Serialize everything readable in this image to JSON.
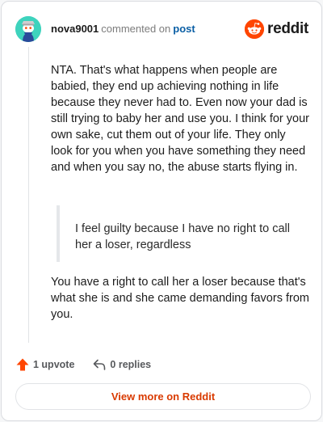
{
  "comment": {
    "username": "nova9001",
    "action_text": "commented on",
    "post_link": "post",
    "brand": "reddit",
    "paragraphs": [
      "NTA. That's what happens when people are babied, they end up achieving nothing in life because they never had to. Even now your dad is still trying to baby her and use you. I think for your own sake, cut them out of your life. They only look for you when you have something they need and when you say no, the abuse starts flying in.",
      "You have a right to call her a loser because that's what she is and she came demanding favors from you."
    ],
    "quote": "I feel guilty because I have no right to call her a loser, regardless"
  },
  "footer": {
    "upvotes": "1 upvote",
    "replies": "0 replies",
    "view_more": "View more on Reddit"
  },
  "colors": {
    "avatar_bg": "#3ed3bd",
    "brand_orange": "#ff4500",
    "link_blue": "#0b5fa5",
    "view_more_text": "#d93a00"
  },
  "icons": {
    "avatar": "snoo-avatar-icon",
    "logo": "reddit-logo-icon",
    "upvote": "upvote-arrow-icon",
    "reply": "reply-arrow-icon"
  }
}
